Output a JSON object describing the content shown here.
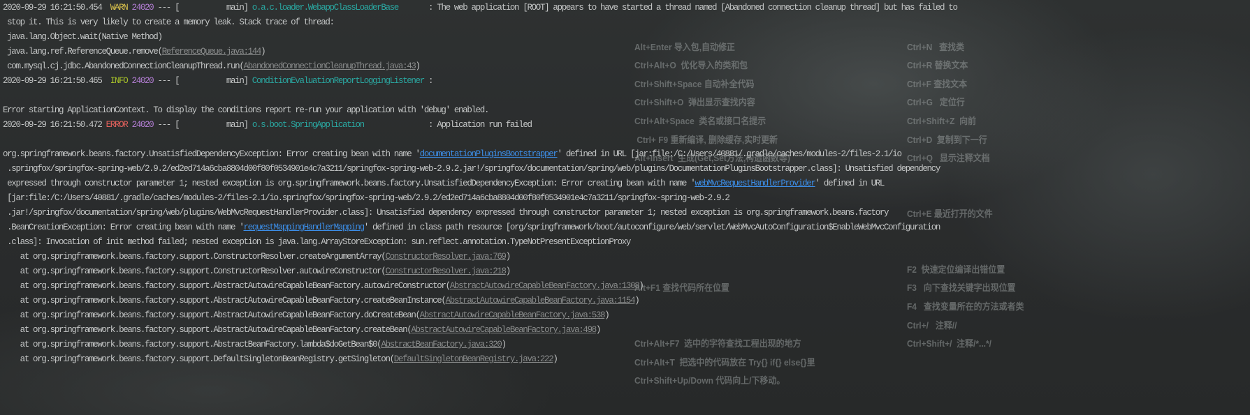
{
  "colors": {
    "warn": "#d9c24c",
    "info": "#a6c02a",
    "error": "#e3615c",
    "pid": "#b57fd6",
    "logger": "#2aa6a0",
    "link": "#3c8ee8",
    "file_link": "#8a8c8c",
    "text": "#c4c6c6"
  },
  "console_lines": [
    [
      {
        "t": "2020-09-29 16:21:50.454  "
      },
      {
        "t": "WARN",
        "c": "warn"
      },
      {
        "t": " "
      },
      {
        "t": "24020",
        "c": "pid"
      },
      {
        "t": " --- [           main] "
      },
      {
        "t": "o.a.c.loader.WebappClassLoaderBase      ",
        "c": "logger"
      },
      {
        "t": " : The web application [ROOT] appears to have started a thread named [Abandoned connection cleanup thread] but has failed to"
      }
    ],
    [
      {
        "t": " stop it. This is very likely to create a memory leak. Stack trace of thread:"
      }
    ],
    [
      {
        "t": " java.lang.Object.wait(Native Method)"
      }
    ],
    [
      {
        "t": " java.lang.ref.ReferenceQueue.remove("
      },
      {
        "t": "ReferenceQueue.java:144",
        "c": "flink"
      },
      {
        "t": ")"
      }
    ],
    [
      {
        "t": " com.mysql.cj.jdbc.AbandonedConnectionCleanupThread.run("
      },
      {
        "t": "AbandonedConnectionCleanupThread.java:43",
        "c": "flink"
      },
      {
        "t": ")"
      }
    ],
    [
      {
        "t": "2020-09-29 16:21:50.465  "
      },
      {
        "t": "INFO",
        "c": "info"
      },
      {
        "t": " "
      },
      {
        "t": "24020",
        "c": "pid"
      },
      {
        "t": " --- [           main] "
      },
      {
        "t": "ConditionEvaluationReportLoggingListener",
        "c": "logger"
      },
      {
        "t": " :"
      }
    ],
    [],
    [
      {
        "t": "Error starting ApplicationContext. To display the conditions report re-run your application with 'debug' enabled."
      }
    ],
    [
      {
        "t": "2020-09-29 16:21:50.472 "
      },
      {
        "t": "ERROR",
        "c": "error"
      },
      {
        "t": " "
      },
      {
        "t": "24020",
        "c": "pid"
      },
      {
        "t": " --- [           main] "
      },
      {
        "t": "o.s.boot.SpringApplication              ",
        "c": "logger"
      },
      {
        "t": " : Application run failed"
      }
    ],
    [],
    [
      {
        "t": "org.springframework.beans.factory.UnsatisfiedDependencyException: Error creating bean with name '"
      },
      {
        "t": "documentationPluginsBootstrapper",
        "c": "link"
      },
      {
        "t": "' defined in URL [jar:file:/C:/Users/40881/.gradle/caches/modules-2/files-2.1/io"
      }
    ],
    [
      {
        "t": " .springfox/springfox-spring-web/2.9.2/ed2ed714a6cba8804d00f80f0534901e4c7a3211/springfox-spring-web-2.9.2.jar!/springfox/documentation/spring/web/plugins/DocumentationPluginsBootstrapper.class]: Unsatisfied dependency"
      }
    ],
    [
      {
        "t": " expressed through constructor parameter 1; nested exception is org.springframework.beans.factory.UnsatisfiedDependencyException: Error creating bean with name '"
      },
      {
        "t": "webMvcRequestHandlerProvider",
        "c": "link"
      },
      {
        "t": "' defined in URL"
      }
    ],
    [
      {
        "t": " [jar:file:/C:/Users/40881/.gradle/caches/modules-2/files-2.1/io.springfox/springfox-spring-web/2.9.2/ed2ed714a6cba8804d00f80f0534901e4c7a3211/springfox-spring-web-2.9.2"
      }
    ],
    [
      {
        "t": " .jar!/springfox/documentation/spring/web/plugins/WebMvcRequestHandlerProvider.class]: Unsatisfied dependency expressed through constructor parameter 1; nested exception is org.springframework.beans.factory"
      }
    ],
    [
      {
        "t": " .BeanCreationException: Error creating bean with name '"
      },
      {
        "t": "requestMappingHandlerMapping",
        "c": "link"
      },
      {
        "t": "' defined in class path resource [org/springframework/boot/autoconfigure/web/servlet/WebMvcAutoConfiguration$EnableWebMvcConfiguration"
      }
    ],
    [
      {
        "t": " .class]: Invocation of init method failed; nested exception is java.lang.ArrayStoreException: sun.reflect.annotation.TypeNotPresentExceptionProxy"
      }
    ],
    [
      {
        "t": "    at org.springframework.beans.factory.support.ConstructorResolver.createArgumentArray("
      },
      {
        "t": "ConstructorResolver.java:769",
        "c": "flink"
      },
      {
        "t": ")"
      }
    ],
    [
      {
        "t": "    at org.springframework.beans.factory.support.ConstructorResolver.autowireConstructor("
      },
      {
        "t": "ConstructorResolver.java:218",
        "c": "flink"
      },
      {
        "t": ")"
      }
    ],
    [
      {
        "t": "    at org.springframework.beans.factory.support.AbstractAutowireCapableBeanFactory.autowireConstructor("
      },
      {
        "t": "AbstractAutowireCapableBeanFactory.java:1308",
        "c": "flink"
      },
      {
        "t": ")"
      }
    ],
    [
      {
        "t": "    at org.springframework.beans.factory.support.AbstractAutowireCapableBeanFactory.createBeanInstance("
      },
      {
        "t": "AbstractAutowireCapableBeanFactory.java:1154",
        "c": "flink"
      },
      {
        "t": ")"
      }
    ],
    [
      {
        "t": "    at org.springframework.beans.factory.support.AbstractAutowireCapableBeanFactory.doCreateBean("
      },
      {
        "t": "AbstractAutowireCapableBeanFactory.java:538",
        "c": "flink"
      },
      {
        "t": ")"
      }
    ],
    [
      {
        "t": "    at org.springframework.beans.factory.support.AbstractAutowireCapableBeanFactory.createBean("
      },
      {
        "t": "AbstractAutowireCapableBeanFactory.java:498",
        "c": "flink"
      },
      {
        "t": ")"
      }
    ],
    [
      {
        "t": "    at org.springframework.beans.factory.support.AbstractBeanFactory.lambda$doGetBean$0("
      },
      {
        "t": "AbstractBeanFactory.java:320",
        "c": "flink"
      },
      {
        "t": ")"
      }
    ],
    [
      {
        "t": "    at org.springframework.beans.factory.support.DefaultSingletonBeanRegistry.getSingleton("
      },
      {
        "t": "DefaultSingletonBeanRegistry.java:222",
        "c": "flink"
      },
      {
        "t": ")"
      }
    ]
  ],
  "watermark_shortcuts": {
    "left": [
      {
        "row": 1,
        "t": "Alt+Enter 导入包,自动修正"
      },
      {
        "row": 2,
        "t": "Ctrl+Alt+O  优化导入的类和包"
      },
      {
        "row": 3,
        "t": "Ctrl+Shift+Space 自动补全代码"
      },
      {
        "row": 4,
        "t": "Ctrl+Shift+O  弹出显示查找内容"
      },
      {
        "row": 5,
        "t": "Ctrl+Alt+Space  类名或接口名提示"
      },
      {
        "row": 6,
        "t": " Ctrl+ F9 重新编译, 删除缓存,实时更新"
      },
      {
        "row": 7,
        "t": "Alt+Insert  生成(Get,Set方法,构造函数等)"
      },
      {
        "row": 14,
        "t": "Alt+F1 查找代码所在位置"
      },
      {
        "row": 17,
        "t": "Ctrl+Alt+F7  选中的字符查找工程出现的地方"
      },
      {
        "row": 18,
        "t": "Ctrl+Alt+T  把选中的代码放在 Try{} if{} else{}里"
      },
      {
        "row": 19,
        "t": "Ctrl+Shift+Up/Down 代码向上/下移动。"
      }
    ],
    "right": [
      {
        "row": 1,
        "t": "Ctrl+N   查找类"
      },
      {
        "row": 2,
        "t": "Ctrl+R 替换文本"
      },
      {
        "row": 3,
        "t": "Ctrl+F 查找文本"
      },
      {
        "row": 4,
        "t": "Ctrl+G   定位行"
      },
      {
        "row": 5,
        "t": "Ctrl+Shift+Z  向前"
      },
      {
        "row": 6,
        "t": "Ctrl+D  复制到下一行"
      },
      {
        "row": 7,
        "t": "Ctrl+Q   显示注释文档"
      },
      {
        "row": 10,
        "t": "Ctrl+E 最近打开的文件"
      },
      {
        "row": 13,
        "t": "F2  快速定位编译出错位置"
      },
      {
        "row": 14,
        "t": "F3   向下查找关键字出现位置"
      },
      {
        "row": 15,
        "t": "F4   查找变量所在的方法或者类"
      },
      {
        "row": 16,
        "t": "Ctrl+/   注释//"
      },
      {
        "row": 17,
        "t": "Ctrl+Shift+/  注释/*...*/"
      }
    ]
  }
}
